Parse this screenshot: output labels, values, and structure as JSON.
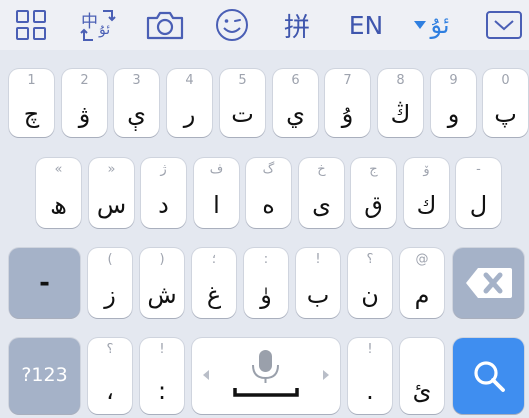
{
  "toolbar": {
    "lang_en": "EN",
    "lang_current": "ئۇ",
    "pinyin": "拼",
    "translate_glyph_top": "中",
    "translate_glyph_bottom": "ئۇ",
    "items": [
      {
        "name": "grid-menu-icon"
      },
      {
        "name": "translate-icon"
      },
      {
        "name": "camera-icon"
      },
      {
        "name": "emoji-icon"
      },
      {
        "name": "pinyin-icon"
      },
      {
        "name": "english-switch"
      },
      {
        "name": "uyghur-language-dropdown"
      },
      {
        "name": "hide-keyboard-icon"
      }
    ],
    "accent_color": "#3f56ad"
  },
  "rows": [
    [
      {
        "hint": "1",
        "label": "چ"
      },
      {
        "hint": "2",
        "label": "ۋ"
      },
      {
        "hint": "3",
        "label": "ې"
      },
      {
        "hint": "4",
        "label": "ر"
      },
      {
        "hint": "5",
        "label": "ت"
      },
      {
        "hint": "6",
        "label": "ي"
      },
      {
        "hint": "7",
        "label": "ۇ"
      },
      {
        "hint": "8",
        "label": "ڭ"
      },
      {
        "hint": "9",
        "label": "و"
      },
      {
        "hint": "0",
        "label": "پ"
      }
    ],
    [
      {
        "hint": "«",
        "label": "ھ"
      },
      {
        "hint": "»",
        "label": "س"
      },
      {
        "hint": "ژ",
        "label": "د"
      },
      {
        "hint": "ف",
        "label": "ا"
      },
      {
        "hint": "گ",
        "label": "ە"
      },
      {
        "hint": "خ",
        "label": "ى"
      },
      {
        "hint": "ج",
        "label": "ق"
      },
      {
        "hint": "ۆ",
        "label": "ك"
      },
      {
        "hint": "-",
        "label": "ل"
      }
    ],
    [
      {
        "hint": "(",
        "label": "ز"
      },
      {
        "hint": ")",
        "label": "ش"
      },
      {
        "hint": "؛",
        "label": "غ"
      },
      {
        "hint": ":",
        "label": "ۈ"
      },
      {
        "hint": "!",
        "label": "ب"
      },
      {
        "hint": "؟",
        "label": "ن"
      },
      {
        "hint": "@",
        "label": "م"
      }
    ]
  ],
  "row3_left": {
    "label": "-"
  },
  "bottom": {
    "num_label": "?123",
    "comma": {
      "hint": "؟",
      "label": "،"
    },
    "colon": {
      "hint": "!",
      "label": ":"
    },
    "period": {
      "hint": "!",
      "label": "."
    },
    "hamza": {
      "hint": "",
      "label": "ئ"
    }
  },
  "colors": {
    "search": "#3f8ef0",
    "function_key": "#a5b2c8"
  }
}
